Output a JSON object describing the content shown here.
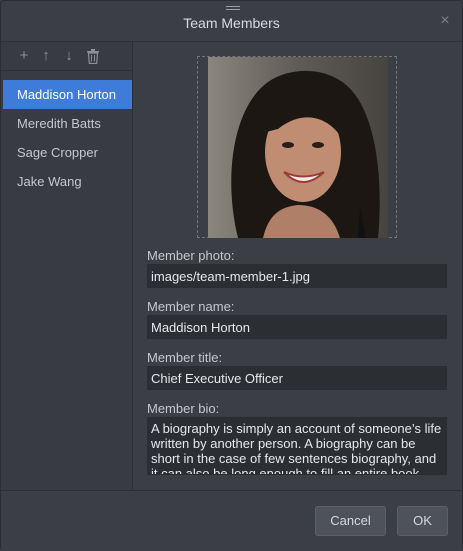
{
  "dialog": {
    "title": "Team Members"
  },
  "toolbar": {
    "add": "+",
    "move_up": "↑",
    "move_down": "↓"
  },
  "members": [
    {
      "name": "Maddison Horton",
      "selected": true
    },
    {
      "name": "Meredith Batts",
      "selected": false
    },
    {
      "name": "Sage Cropper",
      "selected": false
    },
    {
      "name": "Jake Wang",
      "selected": false
    }
  ],
  "form": {
    "photo_label": "Member photo:",
    "photo_value": "images/team-member-1.jpg",
    "name_label": "Member name:",
    "name_value": "Maddison Horton",
    "title_label": "Member title:",
    "title_value": "Chief Executive Officer",
    "bio_label": "Member bio:",
    "bio_value": "A biography is simply an account of someone’s life written by another person. A biography can be short in the case of few sentences biography, and it can also be long enough to fill an entire book."
  },
  "buttons": {
    "cancel": "Cancel",
    "ok": "OK"
  },
  "colors": {
    "accent": "#3f7bd9",
    "background": "#3b3f45",
    "field": "#2b2e33"
  }
}
